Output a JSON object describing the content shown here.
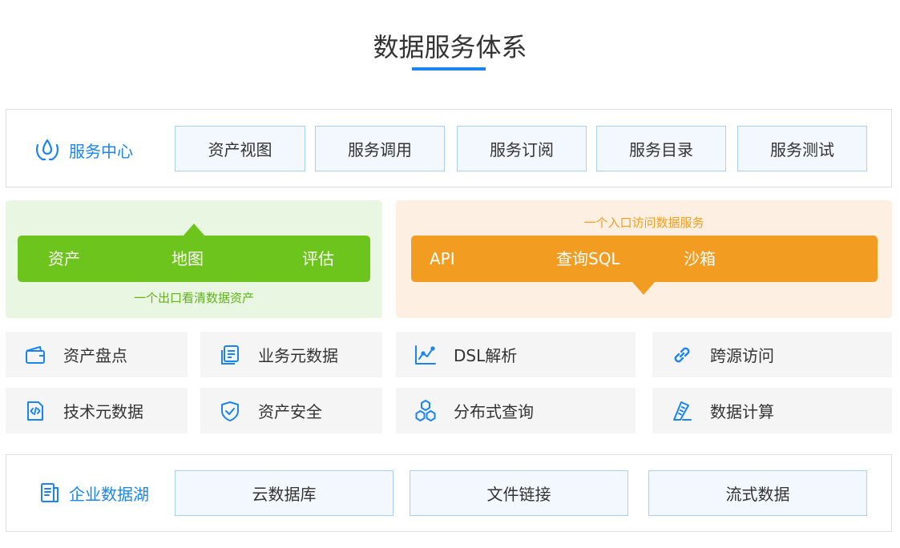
{
  "header": {
    "title": "数据服务体系"
  },
  "service_center": {
    "label": "服务中心",
    "icon": "water-drops-icon",
    "buttons": [
      "资产视图",
      "服务调用",
      "服务订阅",
      "服务目录",
      "服务测试"
    ]
  },
  "asset_panel": {
    "items": [
      "资产",
      "地图",
      "评估"
    ],
    "caption": "一个出口看清数据资产",
    "color": "#6dc41d"
  },
  "access_panel": {
    "caption": "一个入口访问数据服务",
    "items": [
      "API",
      "查询SQL",
      "沙箱"
    ],
    "color": "#f39c22"
  },
  "features": [
    {
      "label": "资产盘点",
      "icon": "wallet-icon"
    },
    {
      "label": "业务元数据",
      "icon": "document-stack-icon"
    },
    {
      "label": "DSL解析",
      "icon": "line-chart-icon"
    },
    {
      "label": "跨源访问",
      "icon": "link-icon"
    },
    {
      "label": "技术元数据",
      "icon": "code-file-icon"
    },
    {
      "label": "资产安全",
      "icon": "shield-check-icon"
    },
    {
      "label": "分布式查询",
      "icon": "hexagons-icon"
    },
    {
      "label": "数据计算",
      "icon": "ruler-icon"
    }
  ],
  "data_lake": {
    "label": "企业数据湖",
    "icon": "book-icon",
    "buttons": [
      "云数据库",
      "文件链接",
      "流式数据"
    ]
  },
  "colors": {
    "accent": "#1a84f0",
    "chip_border": "#a8d0f3",
    "chip_bg": "#f2f8fe",
    "tile_bg": "#f5f5f5"
  }
}
